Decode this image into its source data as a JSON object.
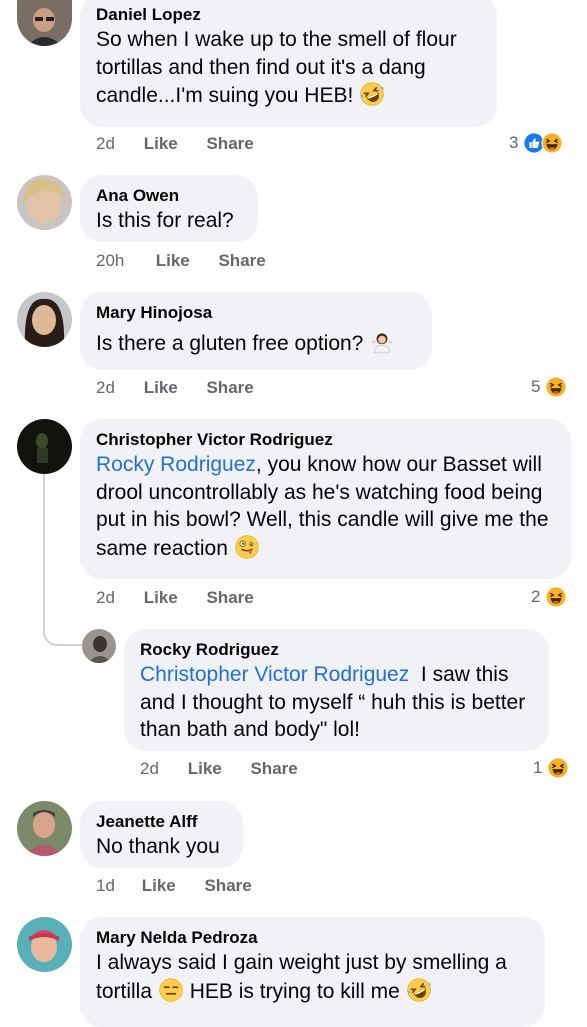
{
  "comments": [
    {
      "author": "Daniel Lopez",
      "text": "So when I wake up to the smell of flour tortillas and then find out it's a dang candle...I'm suing you HEB!",
      "time": "2d",
      "like": "Like",
      "share": "Share",
      "reaction_count": "3",
      "reactions": [
        "like-icon",
        "haha-icon"
      ]
    },
    {
      "author": "Ana Owen",
      "text": "Is this for real?",
      "time": "20h",
      "like": "Like",
      "share": "Share"
    },
    {
      "author": "Mary Hinojosa",
      "text": "Is there a gluten free option?",
      "time": "2d",
      "like": "Like",
      "share": "Share",
      "reaction_count": "5",
      "reactions": [
        "haha-icon"
      ]
    },
    {
      "author": "Christopher Victor Rodriguez",
      "mention": "Rocky Rodriguez",
      "text": ", you know how our Basset will drool uncontrollably as he's watching food being put in his bowl? Well, this candle will give me the same reaction",
      "time": "2d",
      "like": "Like",
      "share": "Share",
      "reaction_count": "2",
      "reactions": [
        "haha-icon"
      ],
      "reply": {
        "author": "Rocky Rodriguez",
        "mention": "Christopher Victor Rodriguez",
        "text": "I saw this and I thought to myself “ huh this is better than bath and body\" lol!",
        "time": "2d",
        "like": "Like",
        "share": "Share",
        "reaction_count": "1",
        "reactions": [
          "haha-icon"
        ]
      }
    },
    {
      "author": "Jeanette Alff",
      "text": "No thank you",
      "time": "1d",
      "like": "Like",
      "share": "Share"
    },
    {
      "author": "Mary Nelda Pedroza",
      "text_a": "I always said I gain weight just by smelling a tortilla",
      "text_b": "HEB is trying to kill me"
    }
  ],
  "colors": {
    "bubble": "#f0f2f5",
    "meta": "#65676b",
    "mention": "#216fdb",
    "like_blue": "#1877f2",
    "haha_yellow": "#f7b125"
  },
  "emoji_names": [
    "rofl-emoji",
    "woman-shrugging-emoji",
    "zany-face-emoji",
    "expressionless-emoji"
  ]
}
